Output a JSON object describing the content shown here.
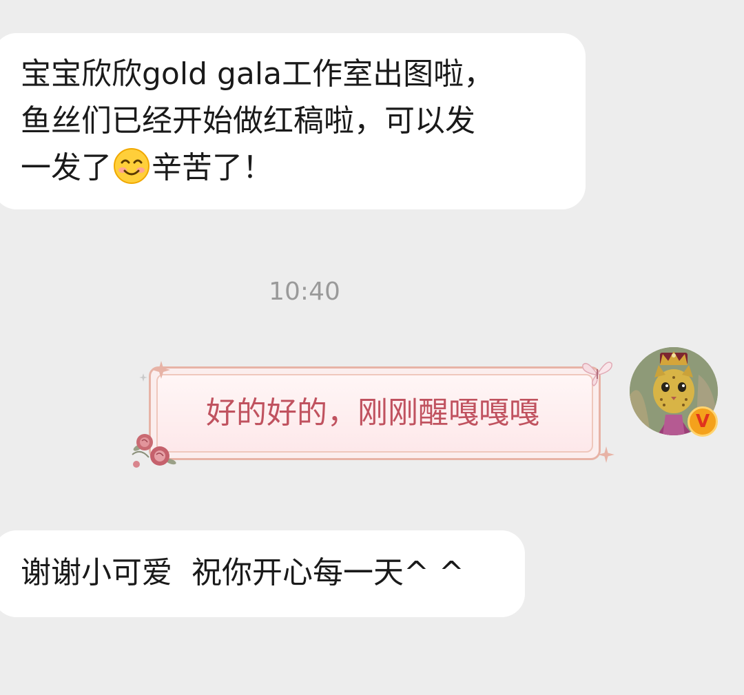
{
  "messages": {
    "incoming_1": {
      "line1": "宝宝欣欣gold gala工作室出图啦，",
      "line2": "鱼丝们已经开始做红稿啦，可以发",
      "line3_before": "一发了",
      "line3_emoji": "smiling-face-emoji",
      "line3_after": "辛苦了！"
    },
    "timestamp": "10:40",
    "outgoing_1": {
      "text": "好的好的，刚刚醒嘎嘎嘎"
    },
    "incoming_2": {
      "text": "谢谢小可爱  祝你开心每一天^ ^"
    }
  },
  "avatar": {
    "icon": "cat-king-avatar",
    "badge_label": "V",
    "badge_color": "#f4a11c"
  },
  "colors": {
    "background": "#ededed",
    "incoming_bubble": "#ffffff",
    "outgoing_text": "#c0525f",
    "timestamp": "#9a9a9a"
  }
}
